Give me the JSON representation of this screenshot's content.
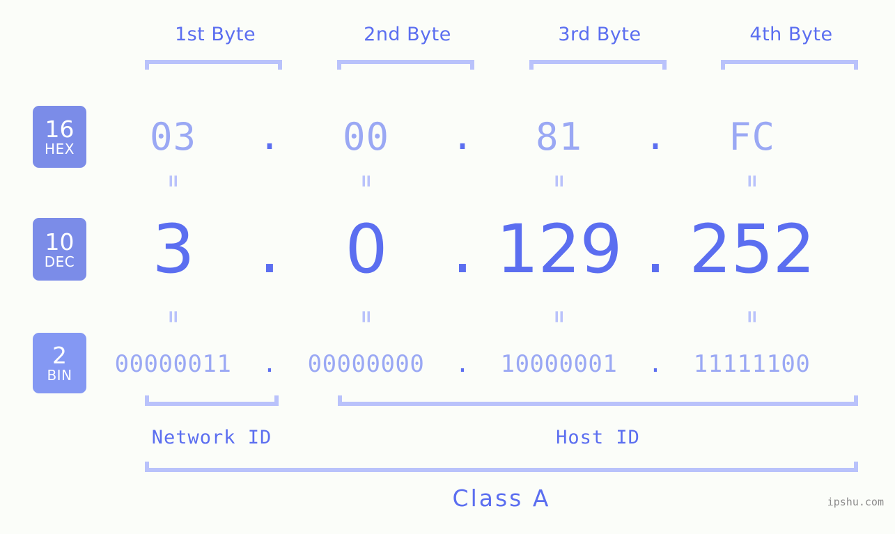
{
  "background": "#fbfdf9",
  "colors": {
    "accent_strong": "#5b6ef0",
    "accent_light": "#9aa8f4",
    "bracket": "#b9c2fb",
    "badge_fill": "#7b8ce8",
    "badge_fill_bin": "#8498f3",
    "watermark": "#8c8c8c"
  },
  "byte_headers": [
    {
      "label": "1st Byte"
    },
    {
      "label": "2nd Byte"
    },
    {
      "label": "3rd Byte"
    },
    {
      "label": "4th Byte"
    }
  ],
  "bases": [
    {
      "number": "16",
      "name": "HEX"
    },
    {
      "number": "10",
      "name": "DEC"
    },
    {
      "number": "2",
      "name": "BIN"
    }
  ],
  "separator": ".",
  "equals_mark": "=",
  "rows": {
    "hex": {
      "base": "16",
      "base_name": "HEX",
      "values": [
        "03",
        "00",
        "81",
        "FC"
      ]
    },
    "dec": {
      "base": "10",
      "base_name": "DEC",
      "values": [
        "3",
        "0",
        "129",
        "252"
      ]
    },
    "bin": {
      "base": "2",
      "base_name": "BIN",
      "values": [
        "00000011",
        "00000000",
        "10000001",
        "11111100"
      ]
    }
  },
  "ip_address": "3.0.129.252",
  "segments": [
    {
      "label": "Network ID",
      "bytes": [
        1
      ]
    },
    {
      "label": "Host ID",
      "bytes": [
        2,
        3,
        4
      ]
    }
  ],
  "class": {
    "label": "Class A"
  },
  "watermark": "ipshu.com"
}
